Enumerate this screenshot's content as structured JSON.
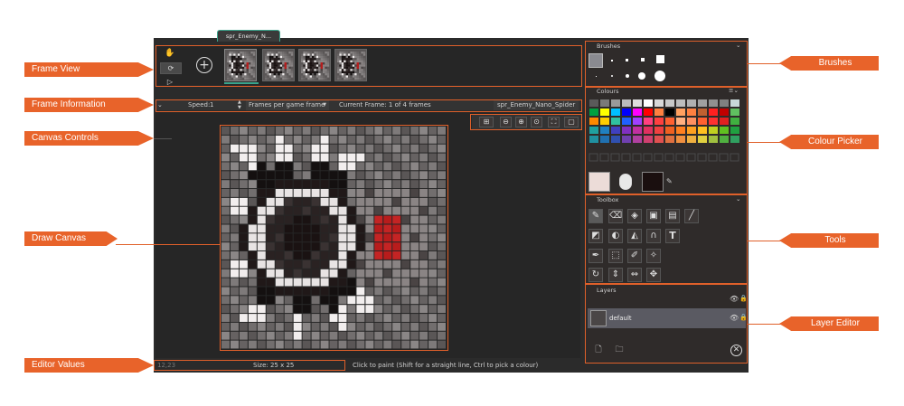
{
  "tab": {
    "title": "spr_Enemy_N..."
  },
  "frame_info": {
    "speed_label": "Speed:",
    "speed_value": "1",
    "speed_mode": "Frames per game frame",
    "current_frame": "Current Frame: 1 of 4 frames",
    "sprite_name": "spr_Enemy_Nano_Spider"
  },
  "panels": {
    "brushes": "Brushes",
    "colours": "Colours",
    "toolbox": "Toolbox",
    "layers": "Layers"
  },
  "layers": [
    {
      "name": "default"
    }
  ],
  "status": {
    "coords": "12,23",
    "size": "Size: 25 x 25",
    "hint": "Click to paint (Shift for a straight line, Ctrl to pick a colour)"
  },
  "annotations": {
    "frame_view": "Frame View",
    "frame_information": "Frame Information",
    "canvas_controls": "Canvas Controls",
    "draw_canvas": "Draw Canvas",
    "editor_values": "Editor Values",
    "brushes": "Brushes",
    "colour_picker": "Colour Picker",
    "tools": "Tools",
    "layer_editor": "Layer Editor"
  },
  "colours": {
    "accent": "#e8632a",
    "row1": [
      "#5a5a5a",
      "#7a7a7a",
      "#9a9a9a",
      "#bcbcbc",
      "#dedede",
      "#ffffff",
      "#d8d8d8",
      "#c8c8c8",
      "#bdbdbd",
      "#b0b0b0",
      "#a0a0a0",
      "#909090",
      "#808080",
      "#c8d8d8"
    ],
    "row2": [
      "#00a040",
      "#ffff00",
      "#00c0ff",
      "#0000ff",
      "#ff00ff",
      "#ff0000",
      "#ff8040",
      "#000000",
      "#ffa060",
      "#ff8040",
      "#c06030",
      "#ff2020",
      "#c00000",
      "#60c060"
    ],
    "row3": [
      "#ff8800",
      "#ffcc00",
      "#30c0a0",
      "#2060ff",
      "#a040ff",
      "#ff4080",
      "#ff4040",
      "#ff6030",
      "#ffb080",
      "#ff9060",
      "#ff6030",
      "#ff3030",
      "#e02020",
      "#40b040"
    ],
    "row4": [
      "#20a0a0",
      "#2080c0",
      "#4040c0",
      "#8030c0",
      "#c030a0",
      "#e03060",
      "#f04040",
      "#f06020",
      "#ff8020",
      "#ffa020",
      "#ffc020",
      "#c0d020",
      "#60c020",
      "#20a040"
    ],
    "row5": [
      "#2090a0",
      "#2070b0",
      "#3050b0",
      "#7040b0",
      "#b040a0",
      "#d04070",
      "#e05050",
      "#e07040",
      "#f09040",
      "#f0b040",
      "#e0d040",
      "#a0c040",
      "#50b040",
      "#30a060"
    ],
    "primary": "#ecdcd8",
    "secondary": "#1a0f0f"
  }
}
